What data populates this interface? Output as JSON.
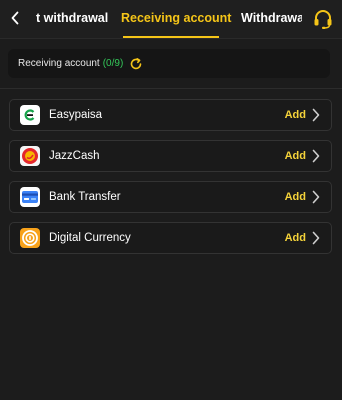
{
  "header": {
    "tabs": [
      {
        "label": "Deposit withdrawal",
        "visible_label": "t withdrawal"
      },
      {
        "label": "Receiving account"
      },
      {
        "label": "Withdrawal record",
        "visible_label": "Withdrawal r"
      }
    ],
    "active_tab": 1,
    "icons": {
      "back": "chevron-left-icon",
      "support": "headset-icon"
    }
  },
  "status": {
    "label": "Receiving account",
    "count": "(0/9)",
    "icon": "refresh-icon"
  },
  "accounts": [
    {
      "name": "Easypaisa",
      "action": "Add",
      "icon": "easypaisa-logo"
    },
    {
      "name": "JazzCash",
      "action": "Add",
      "icon": "jazzcash-logo"
    },
    {
      "name": "Bank Transfer",
      "action": "Add",
      "icon": "bank-card-icon"
    },
    {
      "name": "Digital Currency",
      "action": "Add",
      "icon": "coin-icon"
    }
  ],
  "colors": {
    "accent": "#f5c518",
    "background": "#1c1c1c",
    "count_green": "#34c759",
    "easypaisa_green": "#16a34a",
    "jazzcash_red": "#e3262b",
    "bank_blue": "#3b82f6",
    "coin_orange": "#f7a21b"
  }
}
